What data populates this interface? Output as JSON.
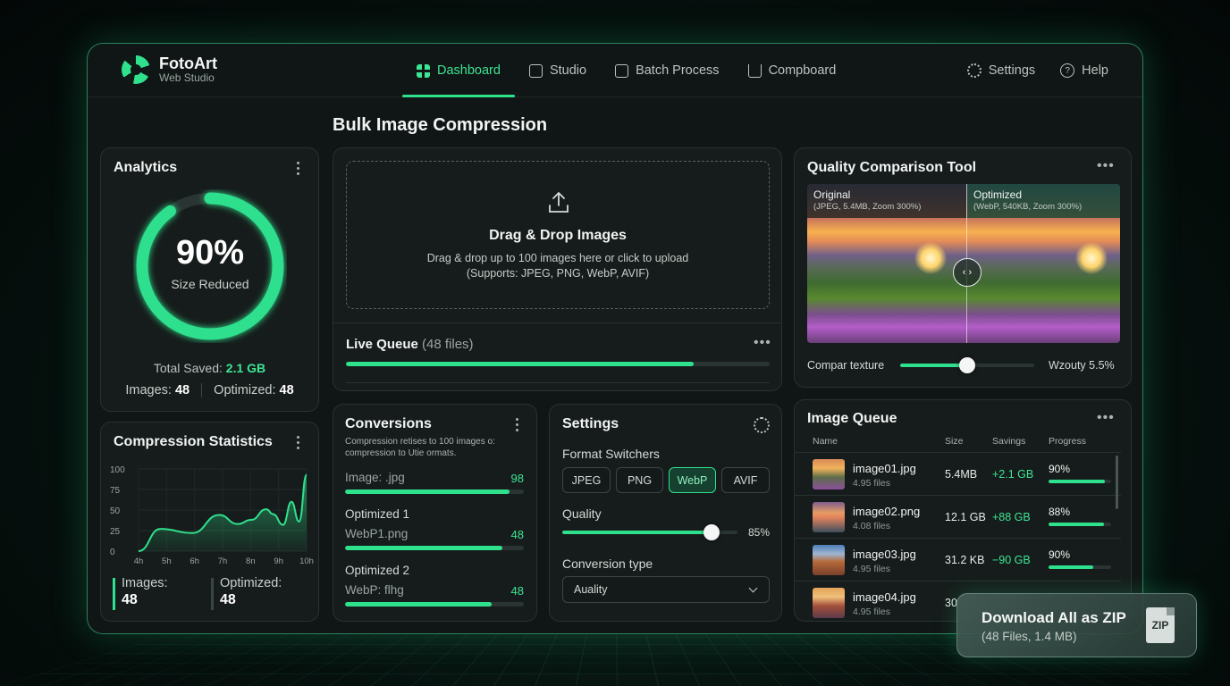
{
  "brand": {
    "name": "FotoArt",
    "sub": "Web Studio"
  },
  "nav": [
    {
      "label": "Dashboard",
      "icon": "dashboard-grid-icon",
      "active": true
    },
    {
      "label": "Studio",
      "icon": "studio-icon"
    },
    {
      "label": "Batch Process",
      "icon": "batch-folder-icon"
    },
    {
      "label": "Compboard",
      "icon": "download-tray-icon"
    }
  ],
  "nav_right": {
    "settings": "Settings",
    "help": "Help"
  },
  "page_title": "Bulk Image Compression",
  "analytics": {
    "title": "Analytics",
    "percent": "90%",
    "percent_value": 0.9,
    "caption": "Size Reduced",
    "total_saved_label": "Total Saved:",
    "total_saved_value": "2.1 GB",
    "images_label": "Images:",
    "images_value": "48",
    "optimized_label": "Optimized:",
    "optimized_value": "48"
  },
  "stats": {
    "title": "Compression Statistics",
    "images_label": "Images:",
    "images_value": "48",
    "optimized_label": "Optimized:",
    "optimized_value": "48"
  },
  "chart_data": {
    "type": "area",
    "x": [
      "4h",
      "5h",
      "6h",
      "7h",
      "8h",
      "9h",
      "10h"
    ],
    "yticks": [
      0,
      25,
      50,
      75,
      100
    ],
    "ylim": [
      0,
      100
    ],
    "values": [
      0,
      27,
      22,
      44,
      33,
      38,
      51,
      45,
      32,
      60,
      36,
      93
    ],
    "xpos": [
      0,
      0.13,
      0.32,
      0.48,
      0.59,
      0.67,
      0.76,
      0.8,
      0.86,
      0.91,
      0.955,
      1.0
    ],
    "tick_labels_x": [
      "4h",
      "5h",
      "6h",
      "7h",
      "8n",
      "9h",
      "10h"
    ],
    "color": "#2fe08d"
  },
  "upload": {
    "title": "Drag & Drop Images",
    "line1": "Drag & drop up to 100 images here or click to upload",
    "line2": "(Supports: JPEG, PNG, WebP, AVIF)"
  },
  "live_queue": {
    "title": "Live Queue",
    "count": "(48 files)",
    "progress": 0.82
  },
  "comparison": {
    "title": "Quality Comparison Tool",
    "left_label": "Original",
    "left_meta": "(JPEG, 5.4MB, Zoom 300%)",
    "right_label": "Optimized",
    "right_meta": "(WebP, 540KB, Zoom 300%)",
    "slider_left": "Compar texture",
    "slider_right": "Wzouty 5.5%",
    "slider_value": 0.5
  },
  "conversions": {
    "title": "Conversions",
    "sub": "Compression retises to 100 images o: compression to Utie ormats.",
    "rows": [
      {
        "label": "Image: .jpg",
        "value": "98",
        "progress": 0.92
      },
      {
        "label": "Optimized 1",
        "sub": "WebP1.png",
        "value": "48",
        "progress": 0.88
      },
      {
        "label": "Optimized 2",
        "sub": "WebP: flhg",
        "value": "48",
        "progress": 0.82
      }
    ]
  },
  "settings": {
    "title": "Settings",
    "format_label": "Format Switchers",
    "formats": [
      "JPEG",
      "PNG",
      "WebP",
      "AVIF"
    ],
    "active_format": "WebP",
    "quality_label": "Quality",
    "quality_value": "85%",
    "quality": 0.85,
    "conversion_label": "Conversion type",
    "conversion_value": "Auality"
  },
  "image_queue": {
    "title": "Image Queue",
    "columns": [
      "Name",
      "Size",
      "Savings",
      "Progress"
    ],
    "rows": [
      {
        "name": "image01.jpg",
        "files": "4.95 files",
        "size": "5.4MB",
        "savings": "+2.1 GB",
        "pct": "90%",
        "progress": 0.9
      },
      {
        "name": "image02.png",
        "files": "4.08 files",
        "size": "12.1 GB",
        "savings": "+88 GB",
        "pct": "88%",
        "progress": 0.88
      },
      {
        "name": "image03.jpg",
        "files": "4.95 files",
        "size": "31.2 KB",
        "savings": "−90 GB",
        "pct": "90%",
        "progress": 0.72
      },
      {
        "name": "image04.jpg",
        "files": "4.95 files",
        "size": "30",
        "savings": "",
        "pct": "",
        "progress": 0
      }
    ]
  },
  "download": {
    "title": "Download All as ZIP",
    "sub": "(48 Files, 1.4 MB)",
    "icon_label": "ZIP"
  }
}
